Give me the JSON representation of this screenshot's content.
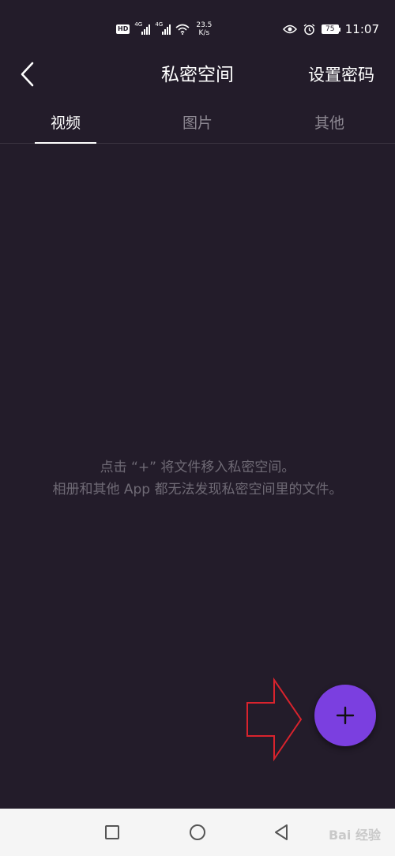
{
  "status_bar": {
    "hd_label": "HD",
    "signal_1_label": "4G",
    "signal_2_label": "4G",
    "net_speed_value": "23.5",
    "net_speed_unit": "K/s",
    "battery": "75",
    "time": "11:07"
  },
  "header": {
    "back_icon": "chevron-left-icon",
    "title": "私密空间",
    "set_password_label": "设置密码"
  },
  "tabs": [
    {
      "label": "视频",
      "active": true
    },
    {
      "label": "图片",
      "active": false
    },
    {
      "label": "其他",
      "active": false
    }
  ],
  "empty_state": {
    "line1": "点击 “+” 将文件移入私密空间。",
    "line2": "相册和其他 App 都无法发现私密空间里的文件。"
  },
  "fab": {
    "icon": "plus-icon",
    "color": "#7b3fe0"
  },
  "annotation": {
    "icon": "arrow-right-outline-icon",
    "color": "#d9232d"
  },
  "nav_bar": {
    "recents_icon": "square-icon",
    "home_icon": "circle-icon",
    "back_icon": "triangle-back-icon"
  },
  "watermark": "Bai 经验"
}
